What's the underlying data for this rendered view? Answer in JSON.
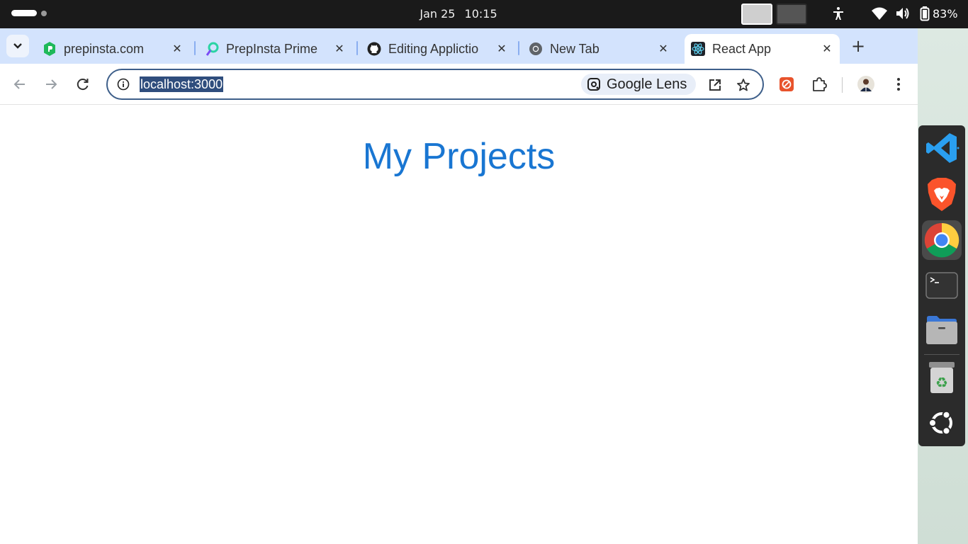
{
  "system_bar": {
    "date": "Jan 25",
    "time": "10:15",
    "battery": "83%",
    "icons": [
      "accessibility-icon",
      "wifi-icon",
      "volume-icon",
      "battery-icon"
    ]
  },
  "tabs": [
    {
      "title": "prepinsta.com",
      "icon": "prepinsta-favicon",
      "active": false
    },
    {
      "title": "PrepInsta Prime",
      "icon": "prepinsta-prime-favicon",
      "active": false
    },
    {
      "title": "Editing Applictio",
      "icon": "github-favicon",
      "active": false
    },
    {
      "title": "New Tab",
      "icon": "chrome-favicon",
      "active": false
    },
    {
      "title": "React App",
      "icon": "react-favicon",
      "active": true
    }
  ],
  "toolbar": {
    "url": "localhost:3000",
    "lens_label": "Google Lens"
  },
  "page": {
    "title": "My Projects"
  },
  "dock": {
    "apps": [
      "vscode-icon",
      "brave-icon",
      "chrome-icon",
      "terminal-icon",
      "files-icon",
      "trash-icon",
      "ubuntu-show-apps-icon"
    ]
  },
  "colors": {
    "tabstrip": "#d3e3fd",
    "heading": "#1976d2",
    "url_highlight": "#2f4d7d",
    "omnibox_border": "#3e5f8a"
  }
}
